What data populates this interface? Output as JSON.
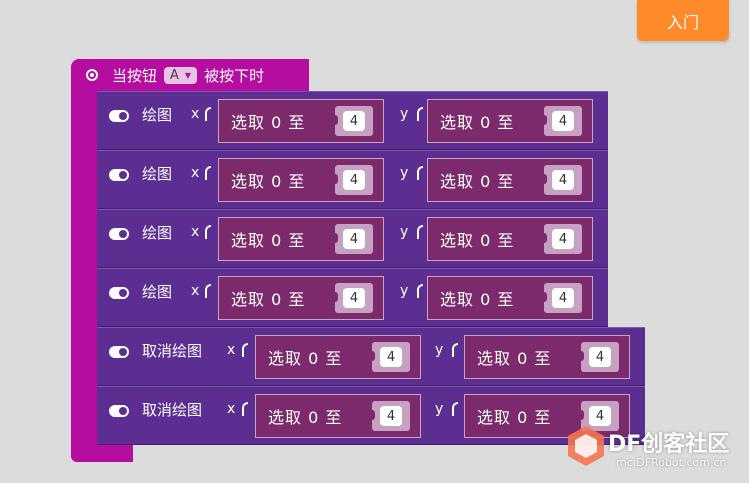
{
  "toolbar": {
    "enter_label": "入门"
  },
  "event_block": {
    "prefix": "当按钮",
    "button_value": "A",
    "suffix": "被按下时"
  },
  "blocks": [
    {
      "label": "绘图",
      "x_axis": "x",
      "y_axis": "y",
      "x_rand": {
        "text": "选取 0 至",
        "max": "4"
      },
      "y_rand": {
        "text": "选取 0 至",
        "max": "4"
      }
    },
    {
      "label": "绘图",
      "x_axis": "x",
      "y_axis": "y",
      "x_rand": {
        "text": "选取 0 至",
        "max": "4"
      },
      "y_rand": {
        "text": "选取 0 至",
        "max": "4"
      }
    },
    {
      "label": "绘图",
      "x_axis": "x",
      "y_axis": "y",
      "x_rand": {
        "text": "选取 0 至",
        "max": "4"
      },
      "y_rand": {
        "text": "选取 0 至",
        "max": "4"
      }
    },
    {
      "label": "绘图",
      "x_axis": "x",
      "y_axis": "y",
      "x_rand": {
        "text": "选取 0 至",
        "max": "4"
      },
      "y_rand": {
        "text": "选取 0 至",
        "max": "4"
      }
    },
    {
      "label": "取消绘图",
      "x_axis": "x",
      "y_axis": "y",
      "x_rand": {
        "text": "选取 0 至",
        "max": "4"
      },
      "y_rand": {
        "text": "选取 0 至",
        "max": "4"
      }
    },
    {
      "label": "取消绘图",
      "x_axis": "x",
      "y_axis": "y",
      "x_rand": {
        "text": "选取 0 至",
        "max": "4"
      },
      "y_rand": {
        "text": "选取 0 至",
        "max": "4"
      }
    }
  ],
  "watermark": {
    "brand": "DF创客社区",
    "url": "mc.DFRobot.com.cn"
  },
  "colors": {
    "event": "#b40da0",
    "statement": "#5c2e91",
    "random": "#7d2a6d",
    "button": "#ff8a2a"
  }
}
